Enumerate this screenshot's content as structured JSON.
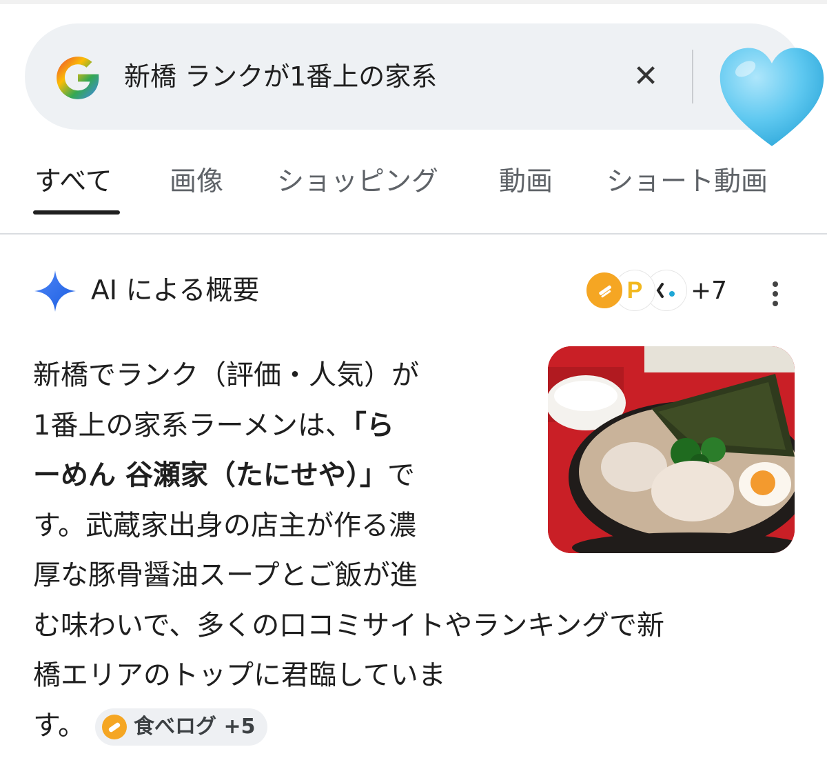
{
  "search": {
    "query": "新橋 ランクが1番上の家系",
    "clear_icon": "close-icon",
    "profile_icon": "light-blue-heart-icon"
  },
  "tabs": [
    {
      "label": "すべて",
      "active": true
    },
    {
      "label": "画像",
      "active": false
    },
    {
      "label": "ショッピング",
      "active": false
    },
    {
      "label": "動画",
      "active": false
    },
    {
      "label": "ショート動画",
      "active": false
    }
  ],
  "ai_overview": {
    "title": "AI による概要",
    "sources_more": "+7",
    "menu_icon": "more-vert-icon",
    "paragraph": {
      "line1": "新橋でランク（評価・人気）が",
      "line2_pre": "1番上の家系ラーメンは、",
      "line2_bold": "「ら",
      "line3_bold": "ーめん 谷瀬家（たにせや）」",
      "line3_post": "で",
      "line4": "す。武蔵家出身の店主が作る濃",
      "line5": "厚な豚骨醤油スープとご飯が進",
      "line6": "む味わいで、多くの口コミサイトやランキングで新",
      "line7": "橋エリアのトップに君臨していま",
      "line8": "す。"
    },
    "citation": {
      "label": "食べログ +5"
    },
    "thumbnail": "ramen-photo"
  },
  "colors": {
    "accent_blue": "#4285f4",
    "heart": "#5ec8f0",
    "text": "#1f1f1f",
    "muted": "#5f6368"
  }
}
